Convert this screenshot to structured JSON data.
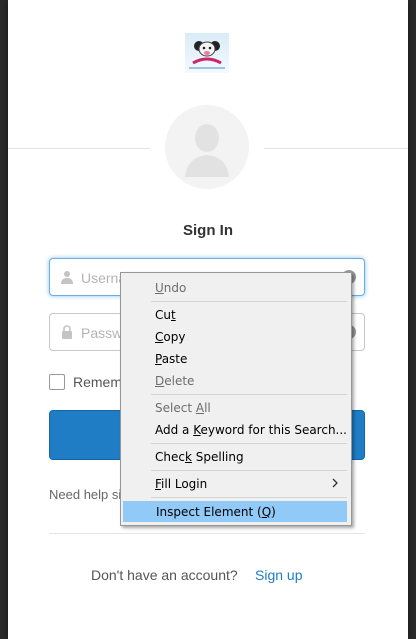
{
  "header": {
    "logo_icon": "brand-logo-icon",
    "avatar_icon": "user-avatar-icon"
  },
  "form": {
    "title": "Sign In",
    "username_placeholder": "Username",
    "password_placeholder": "Password",
    "remember_label": "Remember me",
    "help_text": "Need help signing in?",
    "no_account_text": "Don't have an account?",
    "signup_link": "Sign up"
  },
  "context_menu": {
    "items": [
      {
        "pre": "",
        "key": "U",
        "post": "ndo",
        "enabled": false
      },
      {
        "pre": "Cu",
        "key": "t",
        "post": "",
        "enabled": true
      },
      {
        "pre": "",
        "key": "C",
        "post": "opy",
        "enabled": true
      },
      {
        "pre": "",
        "key": "P",
        "post": "aste",
        "enabled": true
      },
      {
        "pre": "",
        "key": "D",
        "post": "elete",
        "enabled": false
      },
      {
        "pre": "Select ",
        "key": "A",
        "post": "ll",
        "enabled": false
      },
      {
        "pre": "Add a ",
        "key": "K",
        "post": "eyword for this Search...",
        "enabled": true
      },
      {
        "pre": "Chec",
        "key": "k",
        "post": " Spelling",
        "enabled": true
      },
      {
        "pre": "",
        "key": "F",
        "post": "ill Login",
        "enabled": true,
        "submenu": true
      },
      {
        "pre": "Inspect Element (",
        "key": "Q",
        "post": ")",
        "enabled": true,
        "highlighted": true
      }
    ]
  },
  "colors": {
    "accent": "#1f7dc6",
    "menu_highlight": "#91c9f7",
    "focus_ring": "#66afe9"
  }
}
